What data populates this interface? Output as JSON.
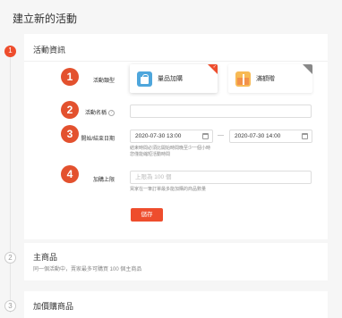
{
  "page": {
    "title": "建立新的活動"
  },
  "steps": [
    {
      "number": "1",
      "title": "活動資訊"
    },
    {
      "number": "2",
      "title": "主商品",
      "subtitle": "同一個活動中，賣家最多可購買 100 個主商品"
    },
    {
      "number": "3",
      "title": "加價購商品"
    }
  ],
  "form": {
    "type_label": "活動類型",
    "type_options": [
      {
        "label": "量品加購",
        "selected": true,
        "icon": "shopping-bag-icon",
        "color": "#4ea6dc"
      },
      {
        "label": "滿額贈",
        "selected": false,
        "icon": "gift-icon",
        "color": "#f7ba55"
      }
    ],
    "name_label": "活動名稱",
    "name_value": "",
    "period_label": "開始/結束日期",
    "start_date": "2020-07-30 13:00",
    "end_date": "2020-07-30 14:00",
    "period_separator": "—",
    "period_hint_line1": "結束時間必須比開始時間晚至少一個小時",
    "period_hint_line2": "您僅能縮短活動時間",
    "limit_label": "加購上限",
    "limit_placeholder": "上限為 100 個",
    "limit_hint": "買家在一筆訂單最多能加購的商品數量",
    "save_label": "儲存"
  },
  "annotation_markers": [
    "1",
    "2",
    "3",
    "4"
  ],
  "colors": {
    "accent": "#ee4d2d",
    "marker": "#e3512e"
  }
}
